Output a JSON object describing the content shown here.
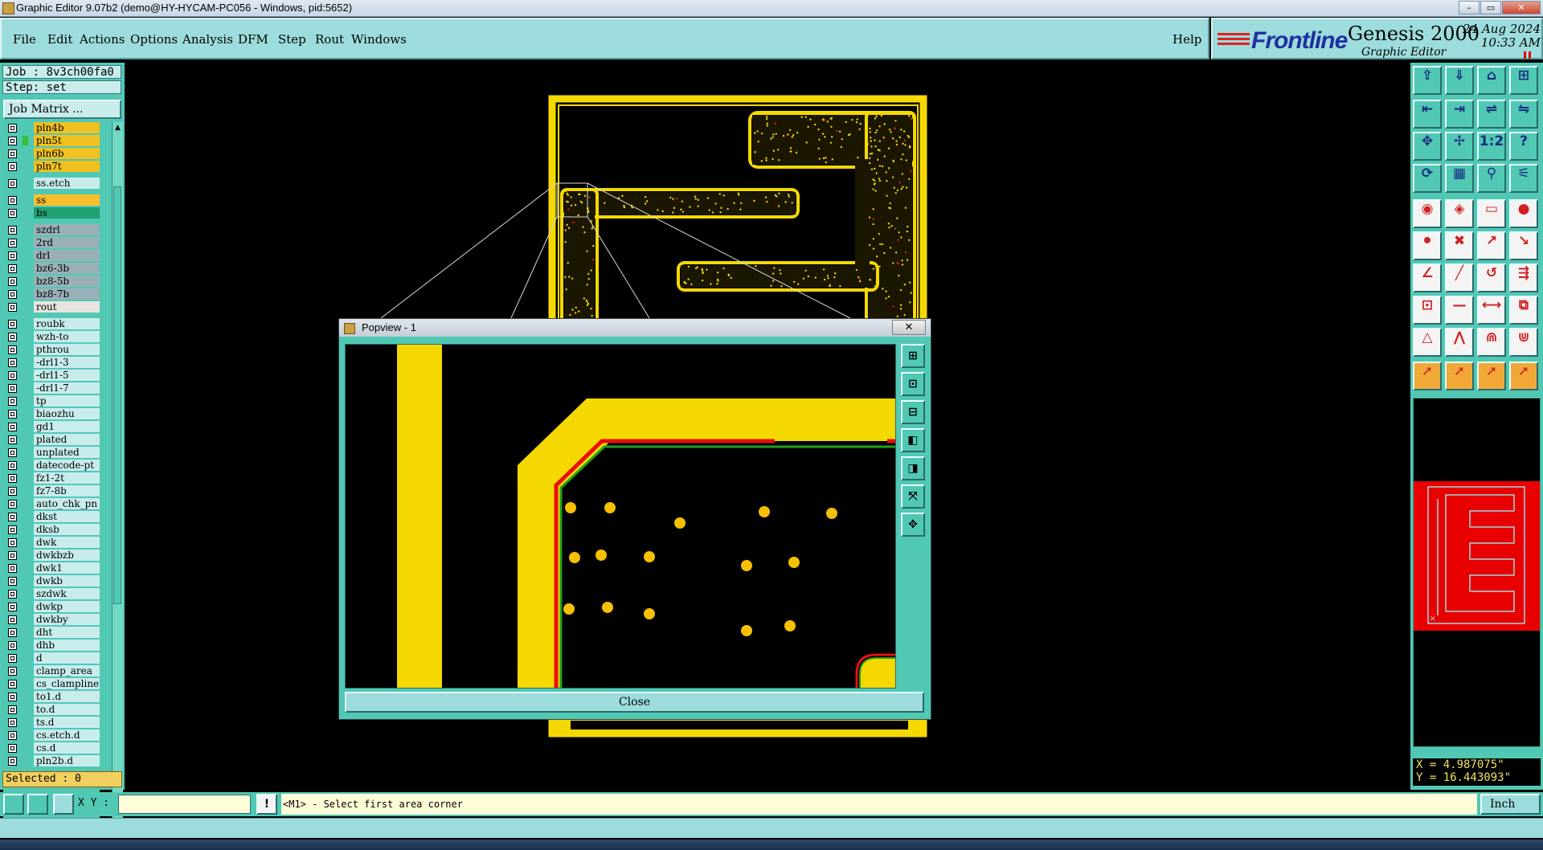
{
  "window": {
    "title": "Graphic Editor 9.07b2 (demo@HY-HYCAM-PC056 - Windows, pid:5652)",
    "controls": [
      "–",
      "▭",
      "✕"
    ]
  },
  "menubar": {
    "items": [
      "File",
      "Edit",
      "Actions",
      "Options",
      "Analysis",
      "DFM",
      "Step",
      "Rout",
      "Windows"
    ],
    "help": "Help"
  },
  "brand": {
    "logo": "Frontline",
    "product": "Genesis 2000",
    "subtitle": "Graphic Editor",
    "date": "24 Aug 2024",
    "time": "10:33 AM"
  },
  "left": {
    "job": "Job : 8v3ch00fa0",
    "step": "Step: set",
    "job_matrix": "Job Matrix ...",
    "selected": "Selected : 0",
    "layers": [
      {
        "name": "pln4b",
        "color": "#f0c020",
        "bg": "#f0c020",
        "mark": ""
      },
      {
        "name": "pln5t",
        "color": "#30c030",
        "bg": "#f0c020",
        "mark": "#30c030"
      },
      {
        "name": "pln6b",
        "color": "#f0c020",
        "bg": "#f0c020",
        "mark": ""
      },
      {
        "name": "pln7t",
        "color": "#f0c020",
        "bg": "#f0c020",
        "mark": ""
      },
      {
        "name": "ss.etch",
        "color": "#c8ecec",
        "bg": "#c8ecec",
        "mark": "",
        "gap": true
      },
      {
        "name": "ss",
        "color": "#f0c020",
        "bg": "#f8c030",
        "mark": "",
        "gap": true
      },
      {
        "name": "bs",
        "color": "#20a060",
        "bg": "#20a070",
        "mark": ""
      },
      {
        "name": "szdrl",
        "color": "#9ab0b8",
        "bg": "#9ab0b8",
        "mark": "",
        "gap": true
      },
      {
        "name": "2rd",
        "color": "#9ab0b8",
        "bg": "#9ab0b8",
        "mark": ""
      },
      {
        "name": "drl",
        "color": "#9ab0b8",
        "bg": "#9ab0b8",
        "mark": ""
      },
      {
        "name": "bz6-3b",
        "color": "#9ab0b8",
        "bg": "#9ab0b8",
        "mark": ""
      },
      {
        "name": "bz8-5b",
        "color": "#9ab0b8",
        "bg": "#9ab0b8",
        "mark": ""
      },
      {
        "name": "bz8-7b",
        "color": "#9ab0b8",
        "bg": "#9ab0b8",
        "mark": ""
      },
      {
        "name": "rout",
        "color": "#e8e4e0",
        "bg": "#e8e4e0",
        "mark": ""
      },
      {
        "name": "roubk",
        "color": "#c8ecec",
        "bg": "#c8ecec",
        "mark": "",
        "gap": true
      },
      {
        "name": "wzh-to",
        "color": "#c8ecec",
        "bg": "#c8ecec",
        "mark": ""
      },
      {
        "name": "pthrou",
        "color": "#c8ecec",
        "bg": "#c8ecec",
        "mark": ""
      },
      {
        "name": "-drl1-3",
        "color": "#c8ecec",
        "bg": "#c8ecec",
        "mark": ""
      },
      {
        "name": "-drl1-5",
        "color": "#c8ecec",
        "bg": "#c8ecec",
        "mark": ""
      },
      {
        "name": "-drl1-7",
        "color": "#c8ecec",
        "bg": "#c8ecec",
        "mark": ""
      },
      {
        "name": "tp",
        "color": "#c8ecec",
        "bg": "#c8ecec",
        "mark": ""
      },
      {
        "name": "biaozhu",
        "color": "#c8ecec",
        "bg": "#c8ecec",
        "mark": ""
      },
      {
        "name": "gd1",
        "color": "#c8ecec",
        "bg": "#c8ecec",
        "mark": ""
      },
      {
        "name": "plated",
        "color": "#c8ecec",
        "bg": "#c8ecec",
        "mark": ""
      },
      {
        "name": "unplated",
        "color": "#c8ecec",
        "bg": "#c8ecec",
        "mark": ""
      },
      {
        "name": "datecode-pt",
        "color": "#c8ecec",
        "bg": "#c8ecec",
        "mark": ""
      },
      {
        "name": "fz1-2t",
        "color": "#c8ecec",
        "bg": "#c8ecec",
        "mark": ""
      },
      {
        "name": "fz7-8b",
        "color": "#c8ecec",
        "bg": "#c8ecec",
        "mark": ""
      },
      {
        "name": "auto_chk_pn",
        "color": "#c8ecec",
        "bg": "#c8ecec",
        "mark": ""
      },
      {
        "name": "dkst",
        "color": "#c8ecec",
        "bg": "#c8ecec",
        "mark": ""
      },
      {
        "name": "dksb",
        "color": "#c8ecec",
        "bg": "#c8ecec",
        "mark": ""
      },
      {
        "name": "dwk",
        "color": "#c8ecec",
        "bg": "#c8ecec",
        "mark": ""
      },
      {
        "name": "dwkbzb",
        "color": "#c8ecec",
        "bg": "#c8ecec",
        "mark": ""
      },
      {
        "name": "dwk1",
        "color": "#c8ecec",
        "bg": "#c8ecec",
        "mark": ""
      },
      {
        "name": "dwkb",
        "color": "#c8ecec",
        "bg": "#c8ecec",
        "mark": ""
      },
      {
        "name": "szdwk",
        "color": "#c8ecec",
        "bg": "#c8ecec",
        "mark": ""
      },
      {
        "name": "dwkp",
        "color": "#c8ecec",
        "bg": "#c8ecec",
        "mark": ""
      },
      {
        "name": "dwkby",
        "color": "#c8ecec",
        "bg": "#c8ecec",
        "mark": ""
      },
      {
        "name": "dht",
        "color": "#c8ecec",
        "bg": "#c8ecec",
        "mark": ""
      },
      {
        "name": "dhb",
        "color": "#c8ecec",
        "bg": "#c8ecec",
        "mark": ""
      },
      {
        "name": "d",
        "color": "#c8ecec",
        "bg": "#c8ecec",
        "mark": ""
      },
      {
        "name": "clamp_area",
        "color": "#c8ecec",
        "bg": "#c8ecec",
        "mark": ""
      },
      {
        "name": "cs_clampline",
        "color": "#c8ecec",
        "bg": "#c8ecec",
        "mark": ""
      },
      {
        "name": "to1.d",
        "color": "#c8ecec",
        "bg": "#c8ecec",
        "mark": ""
      },
      {
        "name": "to.d",
        "color": "#c8ecec",
        "bg": "#c8ecec",
        "mark": ""
      },
      {
        "name": "ts.d",
        "color": "#c8ecec",
        "bg": "#c8ecec",
        "mark": ""
      },
      {
        "name": "cs.etch.d",
        "color": "#c8ecec",
        "bg": "#c8ecec",
        "mark": ""
      },
      {
        "name": "cs.d",
        "color": "#c8ecec",
        "bg": "#c8ecec",
        "mark": ""
      },
      {
        "name": "pln2b.d",
        "color": "#c8ecec",
        "bg": "#c8ecec",
        "mark": ""
      }
    ]
  },
  "right": {
    "coords_x": "X = 4.987075\"",
    "coords_y": "Y = 16.443093\""
  },
  "bottom": {
    "xy_label": "X Y :",
    "xy_value": "",
    "prompt": "<M1> - Select first area corner",
    "units": "Inch"
  },
  "popview": {
    "title": "Popview - 1",
    "close_label": "Close",
    "close_x": "✕"
  }
}
